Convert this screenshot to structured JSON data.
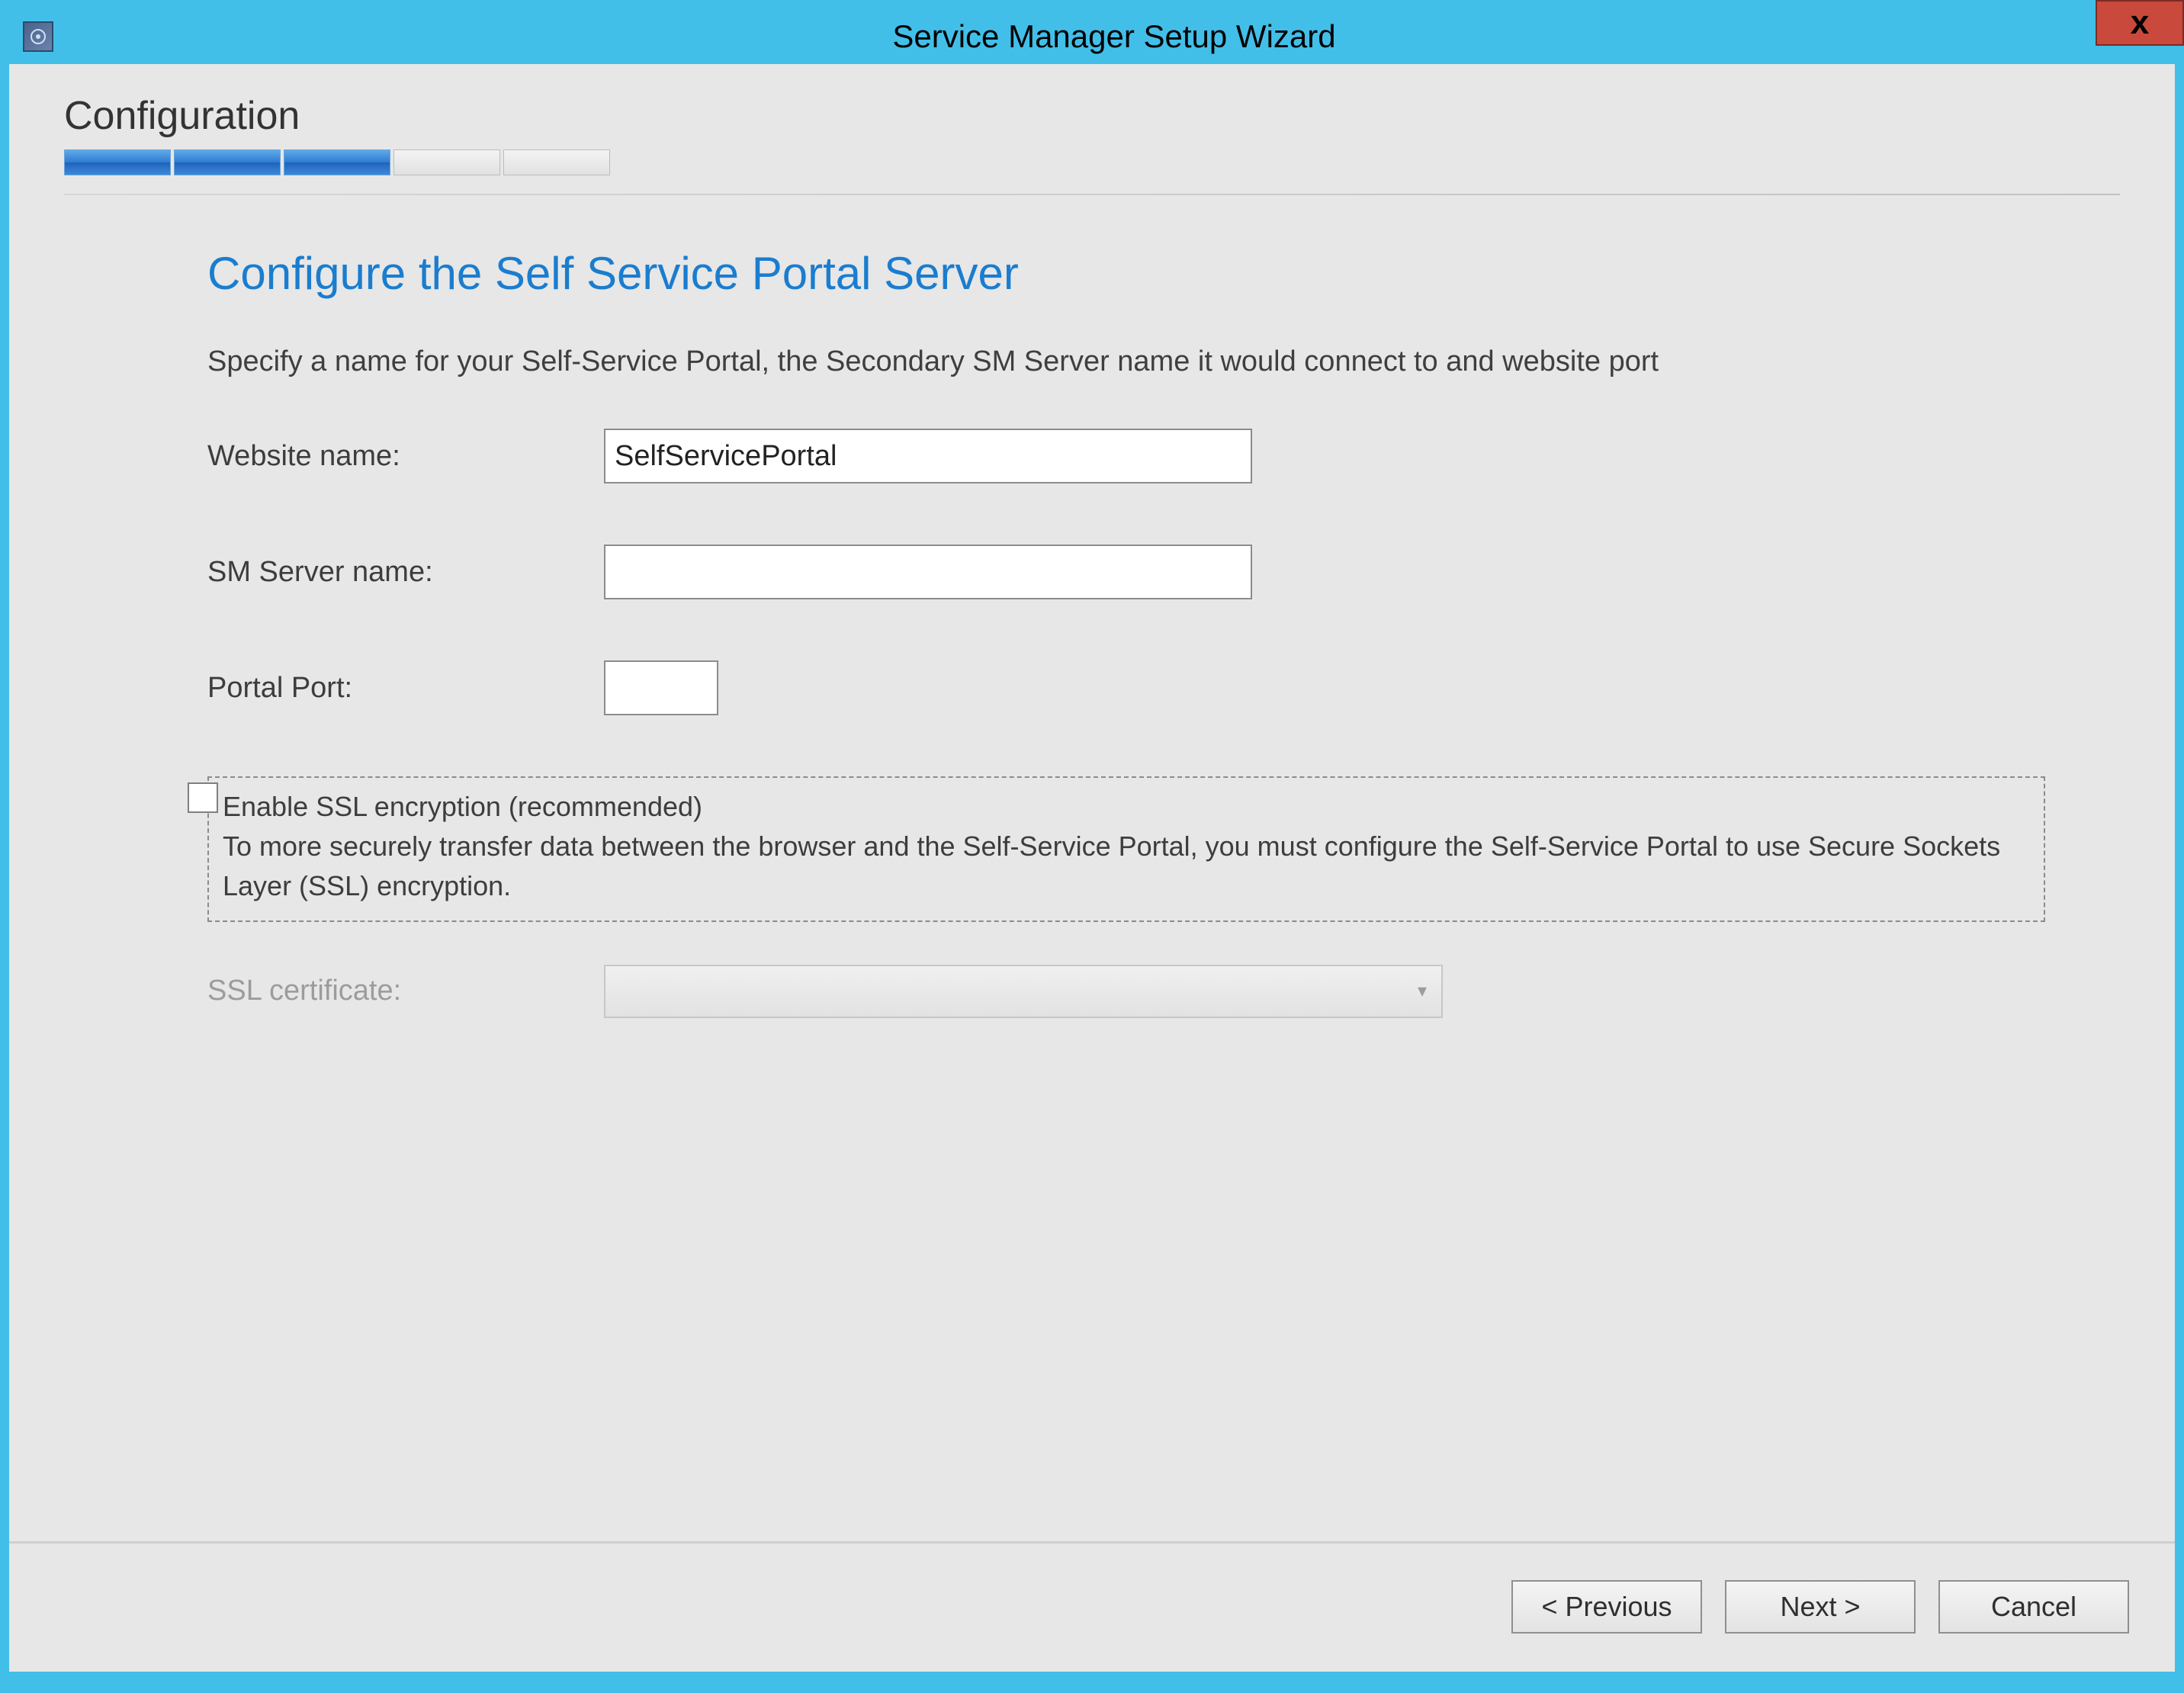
{
  "window": {
    "title": "Service Manager Setup Wizard",
    "close_label": "x"
  },
  "header": {
    "section_title": "Configuration",
    "progress_total": 5,
    "progress_done": 3
  },
  "page": {
    "title": "Configure the Self Service Portal Server",
    "instruction": "Specify a name for your Self-Service Portal, the Secondary SM Server name it would connect to and website port"
  },
  "form": {
    "website_label": "Website name:",
    "website_value": "SelfServicePortal",
    "smserver_label": "SM Server name:",
    "smserver_value": "",
    "port_label": "Portal Port:",
    "port_value": "",
    "ssl_check_label": "Enable SSL encryption (recommended)",
    "ssl_description": "To more securely transfer data between the browser and the Self-Service Portal, you must configure the Self-Service Portal to use Secure Sockets Layer (SSL) encryption.",
    "ssl_cert_label": "SSL certificate:",
    "ssl_cert_value": ""
  },
  "footer": {
    "previous": "< Previous",
    "next": "Next >",
    "cancel": "Cancel"
  }
}
